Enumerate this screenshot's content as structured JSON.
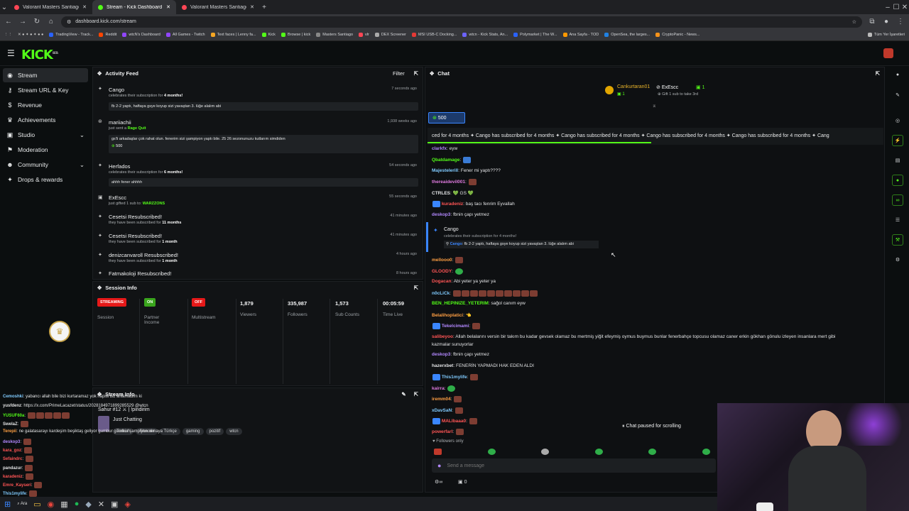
{
  "browser": {
    "tabs": [
      {
        "title": "Valorant Masters Santiago 2026",
        "color": "#ff4655",
        "active": false
      },
      {
        "title": "Stream - Kick Dashboard",
        "color": "#53fc18",
        "active": true
      },
      {
        "title": "Valorant Masters Santiago 2026",
        "color": "#ff4655",
        "active": false
      }
    ],
    "url": "dashboard.kick.com/stream",
    "bookmarks": [
      "TradingView - Track...",
      "Reddit",
      "wtcN's Dashboard",
      "All Games - Twitch",
      "Text faces | Lenny fa...",
      "Kick",
      "Browse | kick",
      "Masters Santiago",
      "vlr",
      "DEX Screener",
      "MSI USB-C Docking...",
      "wtcn - Kick Stats, An...",
      "Polymarket | The W...",
      "Ana Sayfa - TOD",
      "OpenSea, the larges...",
      "CryptoPanic - News..."
    ],
    "all_bookmarks": "Tüm Yer İşaretleri"
  },
  "app": {
    "logo": "KICK",
    "logo_sup": "BETA"
  },
  "sidebar": {
    "items": [
      {
        "label": "Stream",
        "icon": "broadcast-icon"
      },
      {
        "label": "Stream URL & Key",
        "icon": "key-icon"
      },
      {
        "label": "Revenue",
        "icon": "dollar-icon"
      },
      {
        "label": "Achievements",
        "icon": "trophy-icon"
      },
      {
        "label": "Studio",
        "icon": "studio-icon"
      },
      {
        "label": "Moderation",
        "icon": "shield-icon"
      },
      {
        "label": "Community",
        "icon": "people-icon"
      },
      {
        "label": "Drops & rewards",
        "icon": "gift-icon"
      }
    ]
  },
  "activity": {
    "title": "Activity Feed",
    "filter": "Filter",
    "items": [
      {
        "name": "Cango",
        "sub_a": "celebrates their subscription for ",
        "sub_b": "4 months!",
        "time": "7 seconds ago",
        "msg": "fb 2-2 yaptı, haftaya gsye koyup sizi yavaştan 3. lüğe alalım abi"
      },
      {
        "name": "mariiachii",
        "sub_a": "just sent a ",
        "sub_b": "Rage Quit",
        "time": "1,938 weeks ago",
        "msg": "gs'li arkadaşlar çok rahat olun. fenerim sizi şampiyon yaptı bile. 25 26 sezonunuzu kutlarım simdiden",
        "amount": "500"
      },
      {
        "name": "Herfados",
        "sub_a": "celebrates their subscription for ",
        "sub_b": "6 months!",
        "time": "54 seconds ago",
        "msg": "ahhh fener ahhhh"
      },
      {
        "name": "ExEscc",
        "sub_a": "just gifted 1 sub to: ",
        "sub_b": "WARZZONS",
        "time": "55 seconds ago"
      },
      {
        "name": "Cesetsi Resubscribed!",
        "sub_a": "they have been subscribed for ",
        "sub_b": "11 months",
        "time": "41 minutes ago"
      },
      {
        "name": "Cesetsi Resubscribed!",
        "sub_a": "they have been subscribed for ",
        "sub_b": "1 month",
        "time": "41 minutes ago"
      },
      {
        "name": "denizcanvaroll Resubscribed!",
        "sub_a": "they have been subscribed for ",
        "sub_b": "1 month",
        "time": "4 hours ago"
      },
      {
        "name": "Fatmakoloji Resubscribed!",
        "sub_a": "",
        "sub_b": "",
        "time": "8 hours ago"
      }
    ]
  },
  "session": {
    "title": "Session Info",
    "streaming": "STREAMING",
    "session_label": "Session",
    "on": "ON",
    "partner": "Partner Income",
    "off": "OFF",
    "multistream": "Multistream",
    "viewers": "1,879",
    "viewers_label": "Viewers",
    "followers": "335,987",
    "followers_label": "Followers",
    "subs": "1,573",
    "subs_label": "Sub Counts",
    "time": "00:05:59",
    "time_label": "Time Live"
  },
  "stream_info": {
    "title": "Stream Info",
    "stream_title": "Sahur #12 ⚔ | !pindirim",
    "category": "Just Chatting",
    "tags": [
      "Turkish",
      "Shooter",
      "Türkçe",
      "gaming",
      "pozitif",
      "wtcn"
    ]
  },
  "chat": {
    "title": "Chat",
    "top_users": [
      {
        "name": "Cankurtaran01",
        "count": "1"
      },
      {
        "name": "ExEscc",
        "count": "1",
        "note": "Gift 1 sub to take 3rd"
      }
    ],
    "goal": "500",
    "ticker": "ced for 4 months  ✦ Cango has subscribed for 4 months  ✦ Cango has subscribed for 4 months  ✦ Cango has subscribed for 4 months  ✦ Cango has subscribed for 4 months  ✦ Cang",
    "messages": [
      {
        "user": "clarkfx",
        "color": "#b388ff",
        "text": "eyw"
      },
      {
        "user": "Qbatdamage",
        "color": "#53fc18",
        "text": ""
      },
      {
        "user": "Majestelerill",
        "color": "#80cbff",
        "text": "Fener mi yaptı????"
      },
      {
        "user": "thereaidevil001",
        "color": "#e07be0",
        "text": ""
      },
      {
        "user": "CTRLES",
        "color": "#ffffff",
        "text": "💚 GS 💚"
      },
      {
        "user": "kuradeniz",
        "color": "#ff5555",
        "text": "baş tacı fenrim Eyvallah"
      },
      {
        "user": "deskop3",
        "color": "#b388ff",
        "text": "fbnin çapı yetmez"
      }
    ],
    "sub_event": {
      "name": "Cango",
      "note": "celebrates their subscription for 4 months!",
      "user": "Cango",
      "text": "fb 2-2 yaptı, haftaya gsye koyup sizi yavaştan 3. lüğe alalım abi"
    },
    "messages2": [
      {
        "user": "mellooo0",
        "color": "#ff9f43",
        "text": ""
      },
      {
        "user": "GLOODY",
        "color": "#ff5555",
        "text": ""
      },
      {
        "user": "Dogacan",
        "color": "#ff5555",
        "text": "Abi yeter ya yeter ya"
      },
      {
        "user": "n0cLiCk",
        "color": "#80cbff",
        "text": ""
      },
      {
        "user": "BEN_HEPINIZE_YETERIM",
        "color": "#53fc18",
        "text": "sağol canım eyw"
      },
      {
        "user": "Belalihoplatici",
        "color": "#ff9f43",
        "text": "👈"
      },
      {
        "user": "Tekelcimami",
        "color": "#b388ff",
        "text": ""
      },
      {
        "user": "salibeyoo",
        "color": "#ff5555",
        "text": "Allah belalarını versin bir takım bu kadar gevsek olamaz bu mertmiş yiğit efeymiş oymus buymus bunlar fenerbahçe topcusu olamaz caner erkin gökhan gönulu izleyen insanlara mert gibi"
      },
      {
        "user": "",
        "color": "#ffffff",
        "text": "kazmalar sunuyorlar"
      },
      {
        "user": "deskop3",
        "color": "#b388ff",
        "text": "fbnin çapı yetmez"
      },
      {
        "user": "hazerxbet",
        "color": "#e3e4e6",
        "text": "FENERİN YAPMADI HAK EDEN ALDI"
      },
      {
        "user": "This1mylife",
        "color": "#80cbff",
        "text": ""
      },
      {
        "user": "kairra",
        "color": "#e07be0",
        "text": ""
      },
      {
        "user": "iremm04",
        "color": "#ff9f43",
        "text": ""
      },
      {
        "user": "xDavSaN",
        "color": "#80cbff",
        "text": ""
      },
      {
        "user": "MALIbaaa0",
        "color": "#ff5555",
        "text": ""
      },
      {
        "user": "powerfarl",
        "color": "#ff5555",
        "text": ""
      }
    ],
    "paused": "Chat paused for scrolling",
    "followers_only": "Followers only",
    "placeholder": "Send a message",
    "points": "0"
  },
  "left_chat": [
    {
      "user": "Cemoshki",
      "color": "#80cbff",
      "text": "yabancı allah bile bizi kurtaramaz yok hapisi biz anlamadım ki"
    },
    {
      "user": "yusfdenz",
      "color": "#e3e4e6",
      "text": "https://x.com/PrimeLacazet/status/2028184971899285529 @wtcn"
    },
    {
      "user": "YUSUF60a",
      "color": "#53fc18",
      "text": ""
    },
    {
      "user": "SwelaZ",
      "color": "#e3e4e6",
      "text": ""
    },
    {
      "user": "Terepii",
      "color": "#ff9f43",
      "text": "ne galatasarayı kardeşim beşiktaş geliyor gumbur gumbur şampiyon olmaya"
    },
    {
      "user": "deskop3",
      "color": "#b388ff",
      "text": ""
    },
    {
      "user": "kara_goz",
      "color": "#ff5555",
      "text": ""
    },
    {
      "user": "Sefaindrc",
      "color": "#ff5555",
      "text": ""
    },
    {
      "user": "pandazur",
      "color": "#e3e4e6",
      "text": ""
    },
    {
      "user": "karadeniz",
      "color": "#ff5555",
      "text": ""
    },
    {
      "user": "Emre_Kayseri",
      "color": "#ff5555",
      "text": ""
    },
    {
      "user": "This1mylife",
      "color": "#80cbff",
      "text": ""
    }
  ],
  "taskbar": {
    "search": "Ara"
  }
}
